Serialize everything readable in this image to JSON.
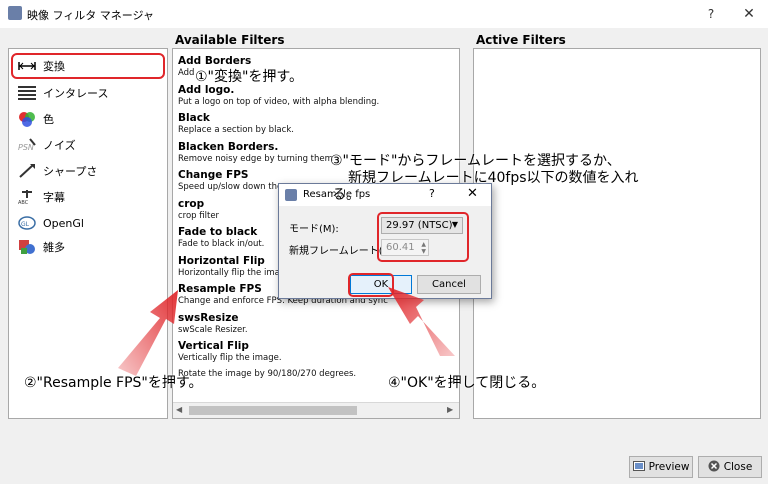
{
  "window": {
    "title": "映像 フィルタ マネージャ",
    "help": "?",
    "close": "✕"
  },
  "headings": {
    "available": "Available Filters",
    "active": "Active Filters"
  },
  "categories": [
    {
      "label": "変換",
      "icon": "transform-icon",
      "selected": true
    },
    {
      "label": "インタレース",
      "icon": "interlace-icon"
    },
    {
      "label": "色",
      "icon": "color-icon"
    },
    {
      "label": "ノイズ",
      "icon": "noise-icon"
    },
    {
      "label": "シャープさ",
      "icon": "sharpness-icon"
    },
    {
      "label": "字幕",
      "icon": "subtitle-icon"
    },
    {
      "label": "OpenGl",
      "icon": "opengl-icon"
    },
    {
      "label": "雑多",
      "icon": "misc-icon"
    }
  ],
  "filters": [
    {
      "name": "Add Borders",
      "desc": "Add"
    },
    {
      "name": "Add logo.",
      "desc": "Put a logo on top of video, with alpha blending."
    },
    {
      "name": "Black",
      "desc": "Replace a section by black."
    },
    {
      "name": "Blacken Borders.",
      "desc": "Remove noisy edge by turning them"
    },
    {
      "name": "Change FPS",
      "desc": "Speed up/slow down the v"
    },
    {
      "name": "crop",
      "desc": "crop filter"
    },
    {
      "name": "Fade to black",
      "desc": "Fade to black in/out."
    },
    {
      "name": "Horizontal Flip",
      "desc": "Horizontally flip the image."
    },
    {
      "name": "Resample FPS",
      "desc": "Change and enforce FPS. Keep duration and sync"
    },
    {
      "name": "swsResize",
      "desc": "swScale Resizer."
    },
    {
      "name": "Vertical Flip",
      "desc": "Vertically flip the image."
    },
    {
      "name": "",
      "desc": "Rotate the image by 90/180/270 degrees."
    }
  ],
  "buttons": {
    "preview": "Preview",
    "close": "Close"
  },
  "dialog": {
    "title": "Resample fps",
    "help": "?",
    "close": "✕",
    "mode_label": "モード(M):",
    "mode_value": "29.97 (NTSC)",
    "framerate_label": "新規フレームレート(N):",
    "framerate_value": "60.41",
    "ok": "OK",
    "cancel": "Cancel"
  },
  "annotations": {
    "step1": "①\"変換\"を押す。",
    "step2": "②\"Resample FPS\"を押す。",
    "step3_line1": "③\"モード\"からフレームレートを選択するか、",
    "step3_line2": "新規フレームレートに40fps以下の数値を入れ",
    "step3_line3": "る。",
    "step4": "④\"OK\"を押して閉じる。"
  },
  "colors": {
    "annotation_red": "#e0262a",
    "ok_border": "#0078d7"
  }
}
